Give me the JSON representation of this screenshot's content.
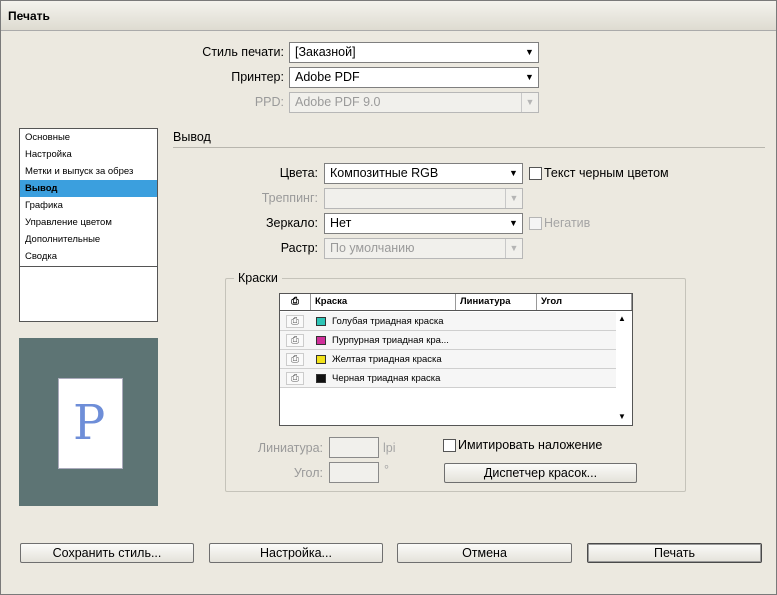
{
  "window": {
    "title": "Печать"
  },
  "top": {
    "style_label": "Стиль печати:",
    "style_value": "[Заказной]",
    "printer_label": "Принтер:",
    "printer_value": "Adobe PDF",
    "ppd_label": "PPD:",
    "ppd_value": "Adobe PDF 9.0"
  },
  "sidebar": {
    "items": [
      {
        "label": "Основные"
      },
      {
        "label": "Настройка"
      },
      {
        "label": "Метки и выпуск за обрез"
      },
      {
        "label": "Вывод",
        "selected": true
      },
      {
        "label": "Графика"
      },
      {
        "label": "Управление цветом"
      },
      {
        "label": "Дополнительные"
      },
      {
        "label": "Сводка"
      }
    ]
  },
  "preview": {
    "page_letter": "P"
  },
  "output": {
    "section_title": "Вывод",
    "color_label": "Цвета:",
    "color_value": "Композитные RGB",
    "text_black_label": "Текст черным цветом",
    "trapping_label": "Треппинг:",
    "trapping_value": "",
    "mirror_label": "Зеркало:",
    "mirror_value": "Нет",
    "negative_label": "Негатив",
    "screening_label": "Растр:",
    "screening_value": "По умолчанию"
  },
  "inks": {
    "group_title": "Краски",
    "columns": {
      "ink": "Краска",
      "frequency": "Линиатура",
      "angle": "Угол"
    },
    "rows": [
      {
        "name": "Голубая триадная краска",
        "color": "#2ec4b6"
      },
      {
        "name": "Пурпурная триадная кра...",
        "color": "#d0309a"
      },
      {
        "name": "Желтая триадная краска",
        "color": "#f2e21a"
      },
      {
        "name": "Черная триадная краска",
        "color": "#111111"
      }
    ],
    "frequency_label": "Линиатура:",
    "frequency_unit": "lpi",
    "angle_label": "Угол:",
    "angle_unit": "°",
    "simulate_overprint_label": "Имитировать наложение",
    "ink_manager_button": "Диспетчер красок..."
  },
  "buttons": {
    "save_style": "Сохранить стиль...",
    "setup": "Настройка...",
    "cancel": "Отмена",
    "print": "Печать"
  }
}
